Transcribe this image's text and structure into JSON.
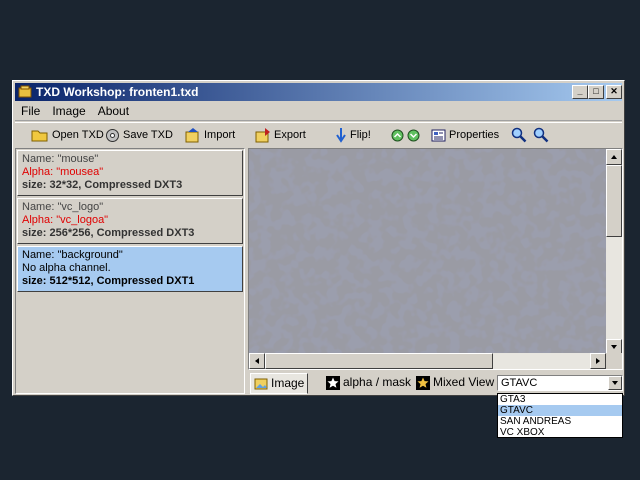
{
  "window": {
    "title": "TXD Workshop: fronten1.txd",
    "controls": {
      "minimize": "_",
      "maximize": "□",
      "close": "✕"
    }
  },
  "menu": [
    "File",
    "Image",
    "About"
  ],
  "toolbar": {
    "open": "Open TXD",
    "save": "Save TXD",
    "import": "Import",
    "export": "Export",
    "flip": "Flip!",
    "properties": "Properties"
  },
  "textures": [
    {
      "name": "Name: \"mouse\"",
      "alpha": "Alpha: \"mousea\"",
      "size": "size: 32*32, Compressed DXT3"
    },
    {
      "name": "Name: \"vc_logo\"",
      "alpha": "Alpha: \"vc_logoa\"",
      "size": "size: 256*256, Compressed DXT3"
    },
    {
      "name": "Name: \"background\"",
      "alpha": "No alpha channel.",
      "size": "size: 512*512, Compressed DXT1"
    }
  ],
  "tabs": [
    "Image",
    "alpha / mask",
    "Mixed View"
  ],
  "game_select": {
    "value": "GTAVC",
    "options": [
      "GTA3",
      "GTAVC",
      "SAN ANDREAS",
      "VC XBOX"
    ]
  },
  "colors": {
    "selection": "#a6caf0",
    "alpha_text": "#e00000",
    "title_start": "#0a246a",
    "title_end": "#a6caf0"
  }
}
